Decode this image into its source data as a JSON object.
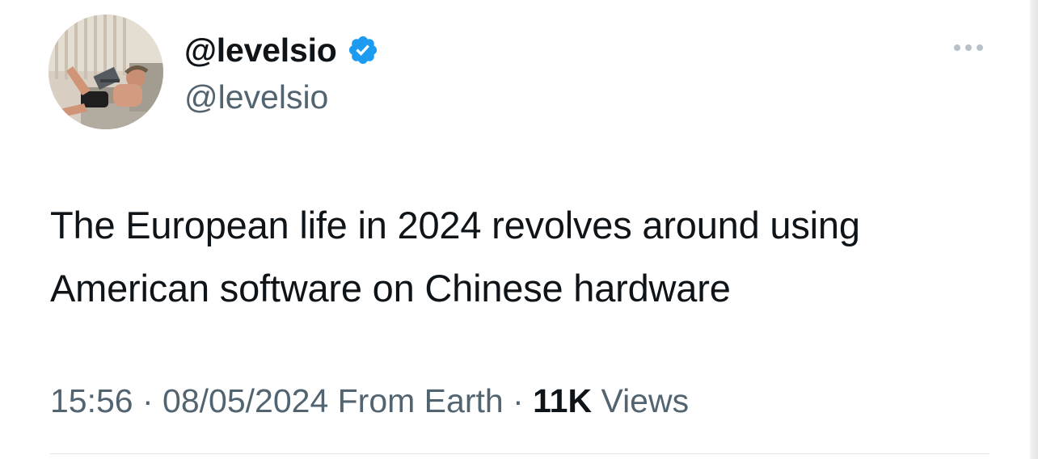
{
  "author": {
    "display_name": "@levelsio",
    "handle": "@levelsio",
    "verified": true,
    "avatar": "profile-photo"
  },
  "tweet": {
    "line1": "The European life in 2024 revolves around using",
    "line2": "American software on Chinese hardware"
  },
  "meta": {
    "time": "15:56",
    "sep1": " · ",
    "date": "08/05/2024",
    "source": " From Earth",
    "sep2": " · ",
    "views_count": "11K",
    "views_label": " Views"
  },
  "icons": {
    "more": "more-icon",
    "verified": "verified-badge-icon"
  },
  "colors": {
    "text": "#0f1419",
    "secondary": "#536471",
    "verified": "#1d9bf0"
  }
}
